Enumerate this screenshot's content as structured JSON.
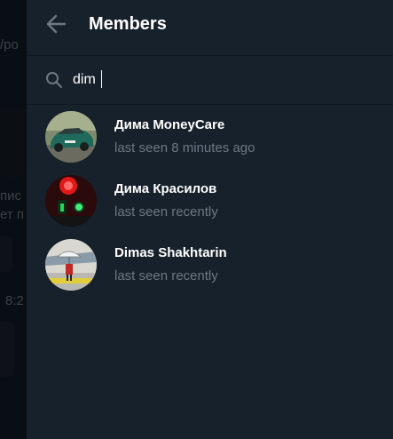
{
  "background": {
    "fragments": [
      "/po",
      "hing",
      "пис",
      "ет п",
      "8:2"
    ]
  },
  "header": {
    "title": "Members",
    "back_icon": "arrow-left-icon"
  },
  "search": {
    "value": "dim",
    "icon": "search-icon"
  },
  "members": [
    {
      "name": "Дима MoneyCare",
      "status": "last seen 8 minutes ago"
    },
    {
      "name": "Дима Красилов",
      "status": "last seen recently"
    },
    {
      "name": "Dimas Shakhtarin",
      "status": "last seen recently"
    }
  ],
  "colors": {
    "panel_bg": "#17212b",
    "secondary_text": "#6c7883",
    "primary_text": "#ffffff"
  }
}
